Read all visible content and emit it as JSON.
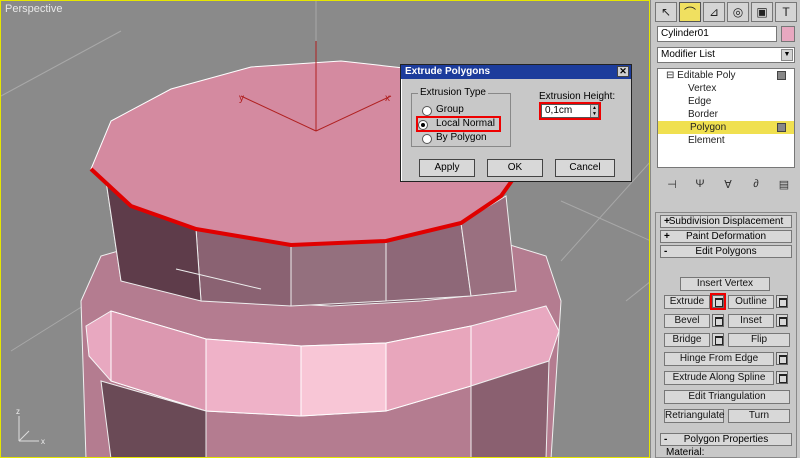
{
  "viewport": {
    "label": "Perspective",
    "axis_x": "x",
    "axis_y": "y",
    "axis_z": "z"
  },
  "dialog": {
    "title": "Extrude Polygons",
    "close_glyph": "✕",
    "group_label": "Extrusion Type",
    "options": [
      "Group",
      "Local Normal",
      "By Polygon"
    ],
    "selected_option": "Local Normal",
    "height_label": "Extrusion Height:",
    "height_value": "0,1cm",
    "apply_label": "Apply",
    "ok_label": "OK",
    "cancel_label": "Cancel"
  },
  "panel": {
    "object_name": "Cylinder01",
    "modifier_list": "Modifier List",
    "stack": {
      "root": "Editable Poly",
      "items": [
        "Vertex",
        "Edge",
        "Border",
        "Polygon",
        "Element"
      ],
      "selected": "Polygon"
    },
    "rollouts": {
      "subdivision_displacement": "Subdivision Displacement",
      "paint_deformation": "Paint Deformation",
      "edit_polygons": "Edit Polygons",
      "polygon_properties": "Polygon Properties",
      "plus": "+",
      "minus": "-"
    },
    "buttons": {
      "insert_vertex": "Insert Vertex",
      "extrude": "Extrude",
      "outline": "Outline",
      "bevel": "Bevel",
      "inset": "Inset",
      "bridge": "Bridge",
      "flip": "Flip",
      "hinge_from_edge": "Hinge From Edge",
      "extrude_along_spline": "Extrude Along Spline",
      "edit_triangulation": "Edit Triangulation",
      "retriangulate": "Retriangulate",
      "turn": "Turn"
    },
    "material_label": "Material:"
  },
  "colors": {
    "selection_red": "#e00000",
    "cylinder_pink": "#d48aa0",
    "viewport_bg": "#8a8a8a",
    "active_highlight": "#f0e050"
  }
}
